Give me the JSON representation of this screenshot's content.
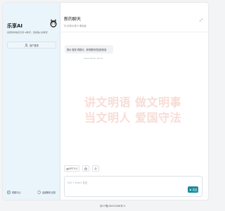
{
  "sidebar": {
    "brand_title": "乐享AI",
    "brand_subtitle": "最懂你的信任引领 AI助手，您的贴心好助手",
    "new_user_label": "用户登录",
    "footer_left": "帮助中心",
    "footer_right": "全部聊天记录"
  },
  "header": {
    "title": "新的聊天",
    "meta": "与 乐享AI 的 0 条对话"
  },
  "messages": [
    {
      "text": "提示:登录 再提问，获得更好的回复体验",
      "time": "2024-08-21 10:23"
    }
  ],
  "watermark": {
    "line1": "讲文明语 做文明事",
    "line2": "当文明人 爱国守法"
  },
  "toolbar": {
    "model_label": "GPT-3.5",
    "clear_icon": "broom-icon",
    "mask_label": "面具"
  },
  "input": {
    "placeholder": "Ctrl + Enter 发送"
  },
  "send_label": "发送",
  "footer": "京ICP备18042566号-3",
  "colors": {
    "accent": "#1a8c9e",
    "sidebar_bg": "#eaf4fb",
    "watermark": "#f8dcd6"
  }
}
